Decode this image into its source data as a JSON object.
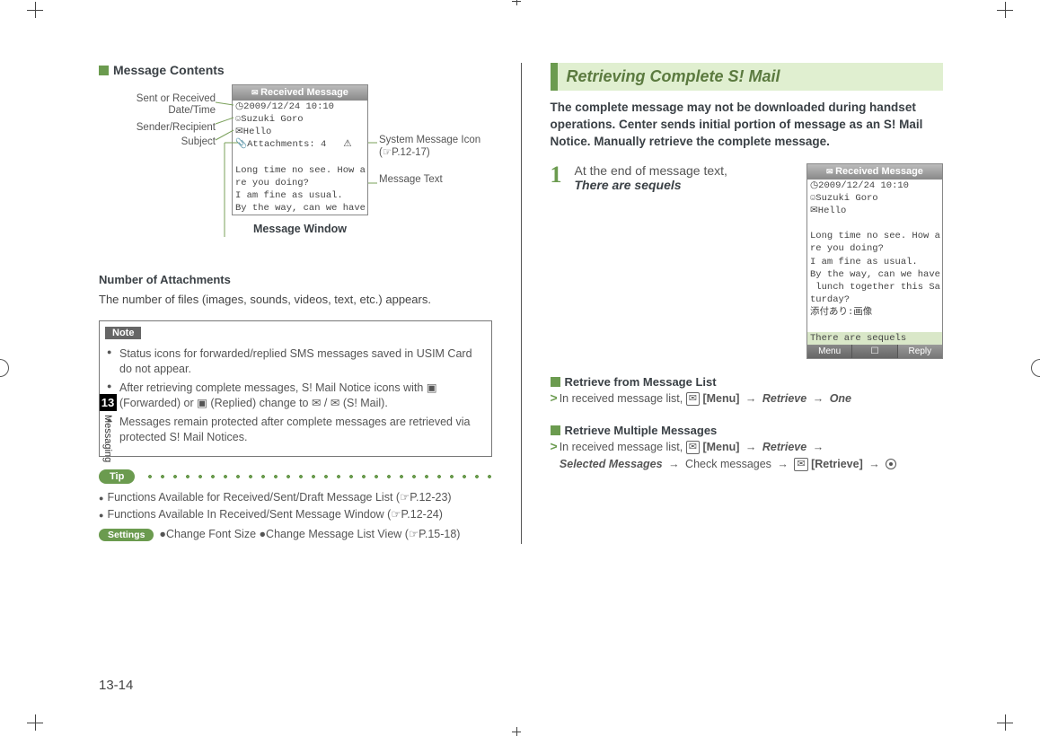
{
  "left": {
    "section_title": "Message Contents",
    "labels": {
      "datetime": "Sent or Received Date/Time",
      "sender": "Sender/Recipient",
      "subject": "Subject",
      "sysicon": "System Message Icon",
      "sysicon_ref": "(☞P.12-17)",
      "msgtext": "Message Text"
    },
    "screen1": {
      "titlebar": "Received Message",
      "datetime": "◷2009/12/24 10:10",
      "sender": "☺Suzuki Goro",
      "subject": "✉Hello",
      "attach": "📎Attachments: 4   ⚠",
      "body1": "Long time no see. How a",
      "body2": "re you doing?",
      "body3": "I am fine as usual.",
      "body4": "By the way, can we have"
    },
    "fig_caption": "Message Window",
    "attach_heading": "Number of Attachments",
    "attach_text": "The number of files (images, sounds, videos, text, etc.) appears.",
    "note_label": "Note",
    "note_items": [
      "Status icons for forwarded/replied SMS messages saved in USIM Card do not appear.",
      "After retrieving complete messages, S! Mail Notice icons with ▣ (Forwarded) or ▣ (Replied) change to ✉ / ✉ (S! Mail).",
      "Messages remain protected after complete messages are retrieved via protected S! Mail Notices."
    ],
    "tip_label": "Tip",
    "tip_line1": "Functions Available for Received/Sent/Draft Message List (☞P.12-23)",
    "tip_line2": "Functions Available In Received/Sent Message Window (☞P.12-24)",
    "settings_label": "Settings",
    "settings_line": "●Change Font Size ●Change Message List View (☞P.15-18)"
  },
  "right": {
    "heading": "Retrieving Complete S! Mail",
    "intro": "The complete message may not be downloaded during handset operations. Center sends initial portion of message as an S! Mail Notice. Manually retrieve the complete message.",
    "step_num": "1",
    "step_line1": "At the end of message text,",
    "step_line2": "There are sequels",
    "screen2": {
      "titlebar": "Received Message",
      "datetime": "◷2009/12/24 10:10",
      "sender": "☺Suzuki Goro",
      "subject": "✉Hello",
      "body1": "Long time no see. How a",
      "body2": "re you doing?",
      "body3": "I am fine as usual.",
      "body4": "By the way, can we have",
      "body5": " lunch together this Sa",
      "body6": "turday?",
      "body7": "添付あり:画像",
      "sequels": "There are sequels",
      "sk_left": "Menu",
      "sk_mid": "☐",
      "sk_right": "Reply"
    },
    "sub1_title": "Retrieve from Message List",
    "sub1_text_prefix": "In received message list, ",
    "sub1_menu": "[Menu]",
    "sub1_retrieve": "Retrieve",
    "sub1_one": "One",
    "sub2_title": "Retrieve Multiple Messages",
    "sub2_text_prefix": "In received message list, ",
    "sub2_selected": "Selected Messages",
    "sub2_check": "Check messages",
    "sub2_retrieve_key": "[Retrieve]"
  },
  "side": {
    "chapnum": "13",
    "chaptxt": "Messaging"
  },
  "page_num": "13-14"
}
